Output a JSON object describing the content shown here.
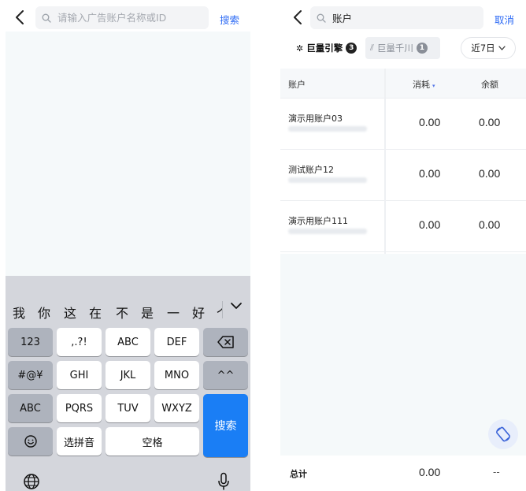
{
  "left": {
    "search": {
      "placeholder": "请输入广告账户名称或ID",
      "value": ""
    },
    "search_button": "搜索",
    "keyboard": {
      "candidates": [
        "我",
        "你",
        "这",
        "在",
        "不",
        "是",
        "一",
        "好",
        "个"
      ],
      "rows": [
        [
          "123",
          ",.?!",
          "ABC",
          "DEF",
          "delete-icon"
        ],
        [
          "#@¥",
          "GHI",
          "JKL",
          "MNO",
          "^^"
        ],
        [
          "ABC",
          "PQRS",
          "TUV",
          "WXYZ",
          "搜索"
        ],
        [
          "emoji-icon",
          "选拼音",
          "空格"
        ]
      ],
      "keys": {
        "k123": "123",
        "punct": ",.?!",
        "abc": "ABC",
        "def": "DEF",
        "sym": "#@¥",
        "ghi": "GHI",
        "jkl": "JKL",
        "mno": "MNO",
        "emo": "^^",
        "abc2": "ABC",
        "pqrs": "PQRS",
        "tuv": "TUV",
        "wxyz": "WXYZ",
        "search": "搜索",
        "pinyin": "选拼音",
        "space": "空格"
      }
    }
  },
  "right": {
    "search": {
      "value": "账户"
    },
    "cancel": "取消",
    "tabs": [
      {
        "label": "巨量引擎",
        "count": "3",
        "active": true
      },
      {
        "label": "巨量千川",
        "count": "1",
        "active": false
      }
    ],
    "period": "近7日",
    "table": {
      "headers": {
        "account": "账户",
        "spend": "消耗",
        "balance": "余额"
      },
      "rows": [
        {
          "name": "演示用账户03",
          "spend": "0.00",
          "balance": "0.00"
        },
        {
          "name": "测试账户12",
          "spend": "0.00",
          "balance": "0.00"
        },
        {
          "name": "演示用账户111",
          "spend": "0.00",
          "balance": "0.00"
        }
      ]
    },
    "footer": {
      "label": "总计",
      "spend": "0.00",
      "balance": "--"
    }
  },
  "colors": {
    "accent": "#2f6cf5",
    "keyboard_primary": "#1a7ef5",
    "keyboard_bg": "#d4d6dc",
    "panel_bg": "#f5f9fa"
  }
}
